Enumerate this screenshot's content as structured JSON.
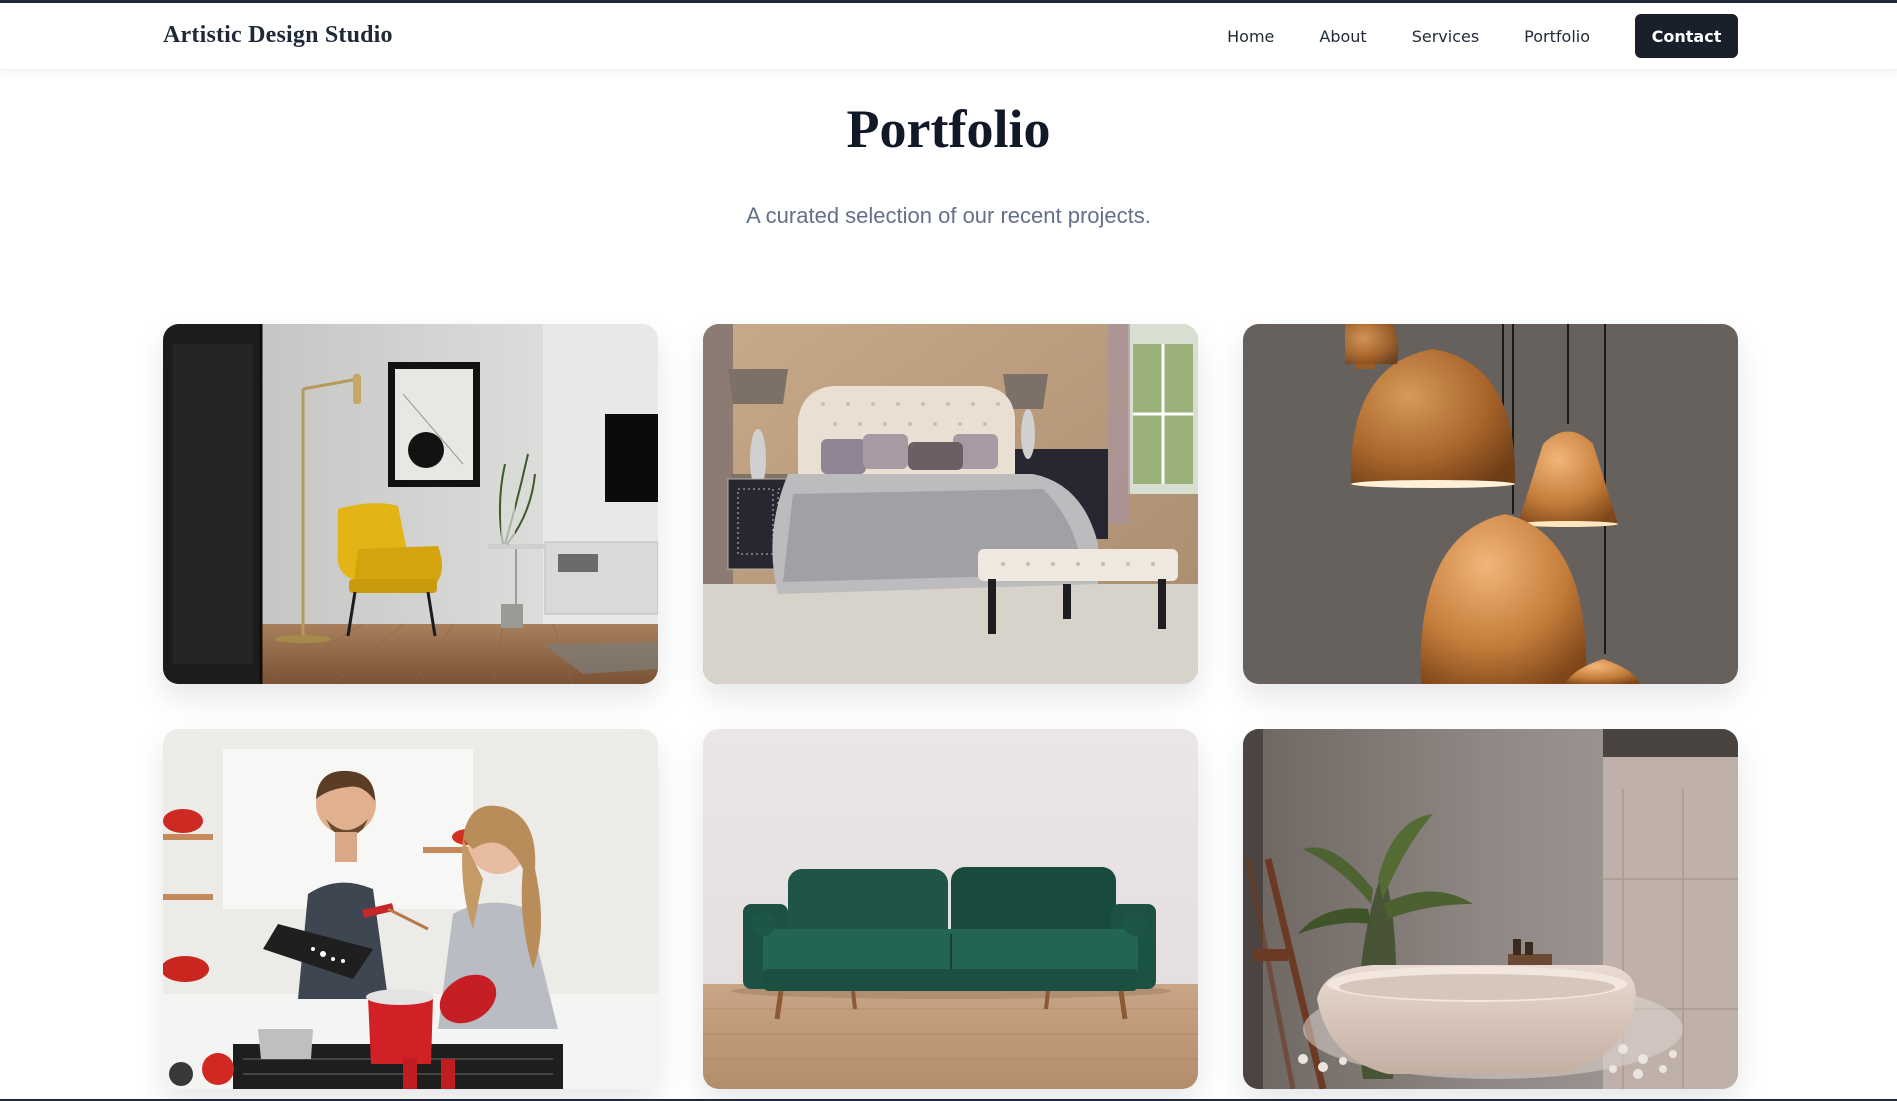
{
  "brand": "Artistic Design Studio",
  "nav": {
    "links": [
      "Home",
      "About",
      "Services",
      "Portfolio"
    ],
    "contact": "Contact"
  },
  "hero": {
    "title": "Portfolio",
    "subtitle": "A curated selection of our recent projects."
  },
  "portfolio": {
    "items": [
      {
        "image": "living-room-yellow-chair-photo"
      },
      {
        "image": "bedroom-tufted-bed-photo"
      },
      {
        "image": "copper-pendant-lamps-photo"
      },
      {
        "image": "couple-cooking-kitchen-photo"
      },
      {
        "image": "green-velvet-sofa-photo"
      },
      {
        "image": "freestanding-bathtub-photo"
      }
    ]
  },
  "colors": {
    "primary": "#1a1f2c",
    "text": "#111827",
    "muted": "#64708a"
  }
}
